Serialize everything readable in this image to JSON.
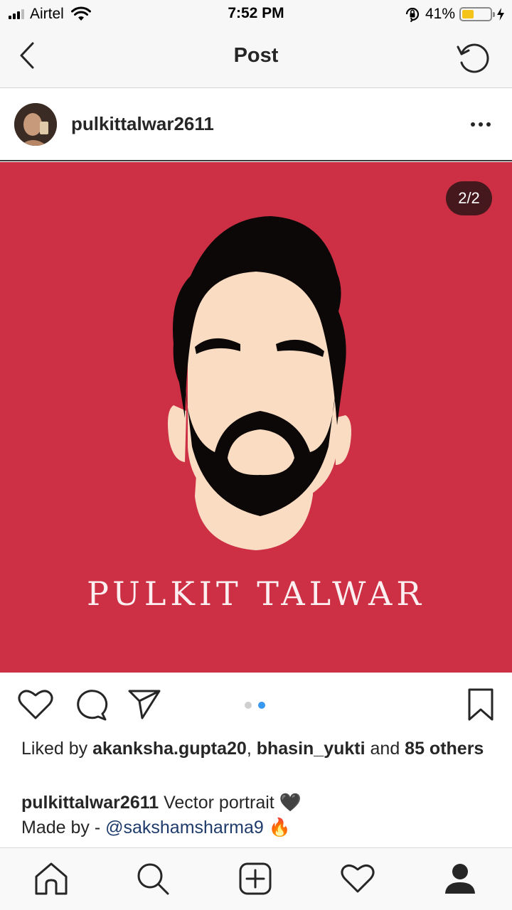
{
  "status_bar": {
    "carrier": "Airtel",
    "time": "7:52 PM",
    "battery_percent": "41%",
    "battery_level": 0.41,
    "icons": [
      "signal-icon",
      "wifi-icon",
      "orientation-lock-icon",
      "battery-icon",
      "charging-icon"
    ]
  },
  "nav": {
    "title": "Post",
    "back_icon": "chevron-left-icon",
    "refresh_icon": "refresh-icon"
  },
  "post": {
    "username": "pulkittalwar2611",
    "more_icon": "more-horizontal-icon",
    "image_counter": "2/2",
    "image_text": "PULKIT TALWAR",
    "image_background": "#cd3045",
    "carousel_index": 2,
    "carousel_total": 2
  },
  "actions": {
    "icons": [
      "heart-icon",
      "comment-icon",
      "share-icon",
      "bookmark-icon"
    ]
  },
  "likes": {
    "prefix": "Liked by ",
    "user1": "akanksha.gupta20",
    "separator": ", ",
    "user2": "bhasin_yukti",
    "conjunction": " and ",
    "others": "85 others"
  },
  "caption": {
    "username": "pulkittalwar2611",
    "text": " Vector portrait ",
    "emoji1": "🖤",
    "line2_prefix": "Made by - ",
    "mention": "@sakshamsharma9",
    "emoji2": "🔥"
  },
  "tabbar": {
    "icons": [
      "home-icon",
      "search-icon",
      "new-post-icon",
      "activity-heart-icon",
      "profile-icon"
    ]
  },
  "colors": {
    "accent_blue": "#3897f0",
    "mention": "#1e3b6b",
    "battery_fill": "#f4c41b"
  }
}
